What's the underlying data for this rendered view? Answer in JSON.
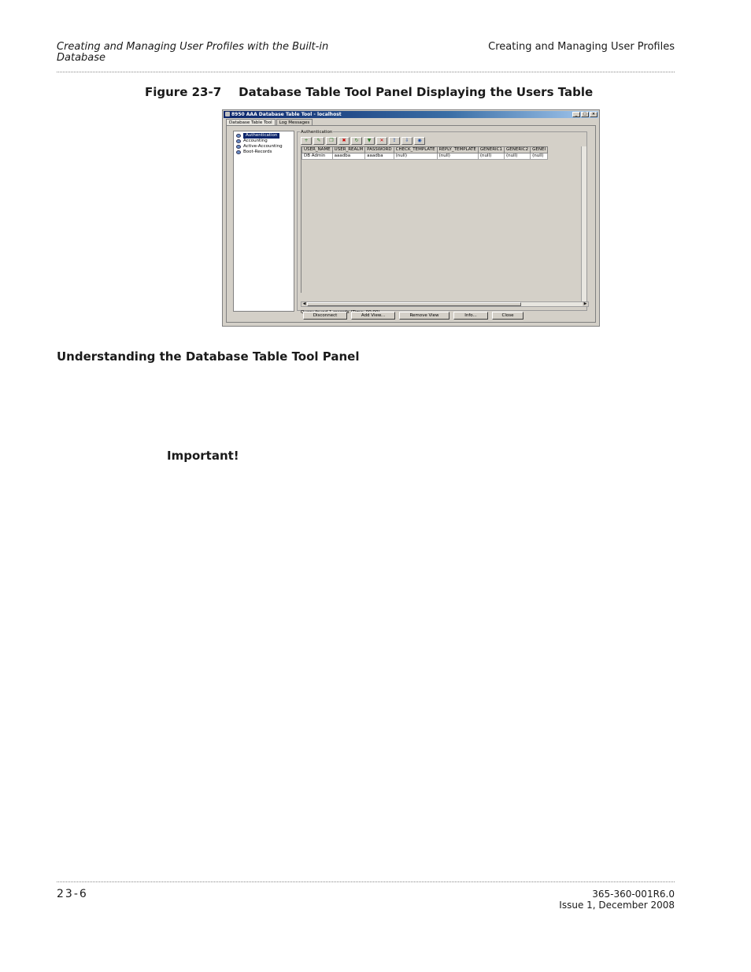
{
  "header": {
    "left_title": "Creating and Managing User Profiles with the Built-in Database",
    "right_title": "Creating and Managing User Profiles"
  },
  "figure": {
    "label": "Figure 23-7",
    "caption": "Database Table Tool Panel Displaying the Users Table"
  },
  "window": {
    "title": "8950 AAA Database Table Tool - localhost",
    "controls": [
      "_",
      "□",
      "×"
    ],
    "tabs": [
      "Database Table Tool",
      "Log Messages"
    ],
    "tree": [
      "Authentication",
      "Accounting",
      "Active-Accounting",
      "Boot-Records"
    ],
    "group_title": "Authentication",
    "toolbar_icons": [
      "add-icon",
      "edit-icon",
      "copy-icon",
      "delete-icon",
      "refresh-icon",
      "filter-icon",
      "clear-filter-icon",
      "export-icon",
      "import-icon",
      "view-icon"
    ],
    "table": {
      "columns": [
        "USER_NAME",
        "USER_REALM",
        "PASSWORD",
        "CHECK_TEMPLATE",
        "REPLY_TEMPLATE",
        "GENERIC1",
        "GENERIC2",
        "GENEI"
      ],
      "rows": [
        [
          "DB Admin",
          "aaadba",
          "aaadba",
          "(null)",
          "(null)",
          "(null)",
          "(null)",
          "(null)"
        ]
      ]
    },
    "status": "Query found 1 records (Time: 00:00)",
    "buttons": [
      "Disconnect",
      "Add View...",
      "Remove View",
      "Info...",
      "Close"
    ]
  },
  "section": {
    "title": "Understanding the Database Table Tool Panel"
  },
  "important": "Important!",
  "footer": {
    "page_number": "23-6",
    "doc_id": "365-360-001R6.0",
    "issue": "Issue 1, December 2008"
  }
}
